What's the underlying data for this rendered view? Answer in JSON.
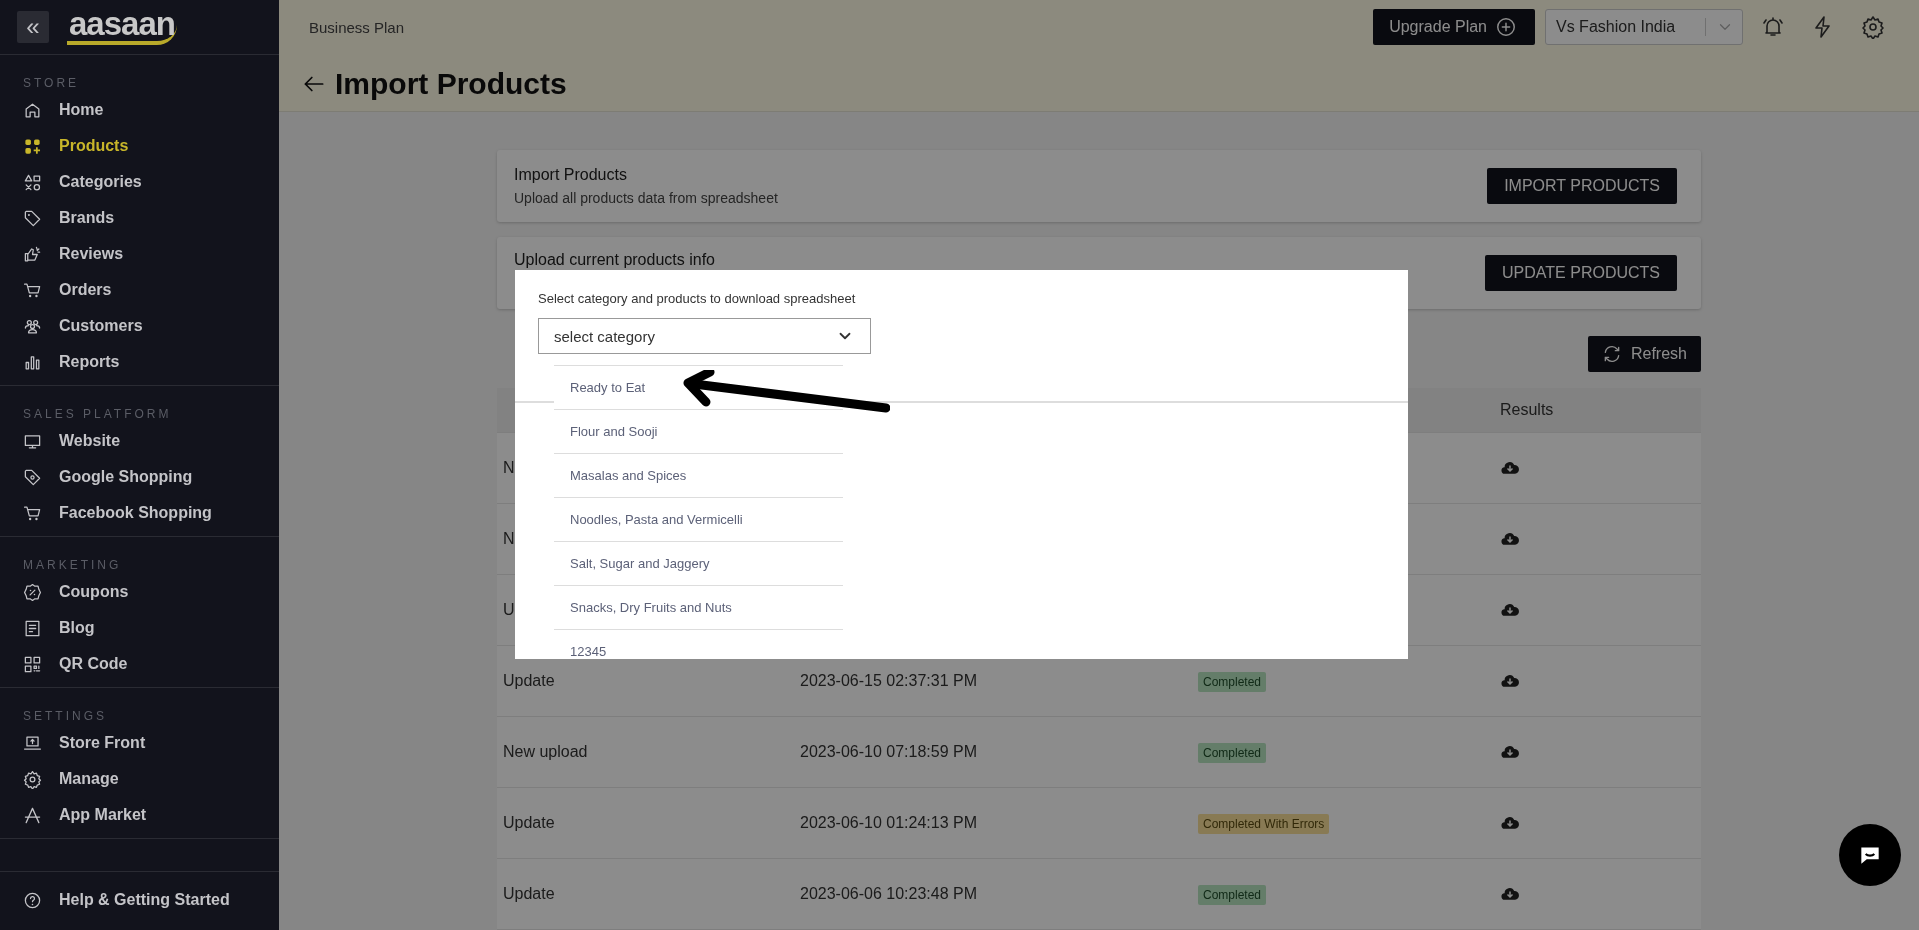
{
  "sidebar": {
    "collapse": "«",
    "logo": "aasaan",
    "sections": [
      {
        "label": "STORE",
        "items": [
          {
            "label": "Home",
            "selected": false
          },
          {
            "label": "Products",
            "selected": true
          },
          {
            "label": "Categories",
            "selected": false
          },
          {
            "label": "Brands",
            "selected": false
          },
          {
            "label": "Reviews",
            "selected": false
          },
          {
            "label": "Orders",
            "selected": false
          },
          {
            "label": "Customers",
            "selected": false
          },
          {
            "label": "Reports",
            "selected": false
          }
        ]
      },
      {
        "label": "SALES PLATFORM",
        "items": [
          {
            "label": "Website",
            "selected": false
          },
          {
            "label": "Google Shopping",
            "selected": false
          },
          {
            "label": "Facebook Shopping",
            "selected": false
          }
        ]
      },
      {
        "label": "MARKETING",
        "items": [
          {
            "label": "Coupons",
            "selected": false
          },
          {
            "label": "Blog",
            "selected": false
          },
          {
            "label": "QR Code",
            "selected": false
          }
        ]
      },
      {
        "label": "SETTINGS",
        "items": [
          {
            "label": "Store Front",
            "selected": false
          },
          {
            "label": "Manage",
            "selected": false
          },
          {
            "label": "App Market",
            "selected": false
          }
        ]
      }
    ],
    "help": "Help & Getting Started"
  },
  "header": {
    "plan": "Business Plan",
    "upgrade_button": "Upgrade Plan",
    "store_select": {
      "value": "Vs Fashion India"
    },
    "page_title": "Import Products"
  },
  "cards": [
    {
      "title": "Import Products",
      "subtitle": "Upload all products data from spreadsheet",
      "button": "IMPORT PRODUCTS"
    },
    {
      "title": "Upload current products info",
      "button": "UPDATE PRODUCTS"
    }
  ],
  "refresh_button": "Refresh",
  "table": {
    "results_heading": "Results",
    "rows": [
      {
        "type": "N"
      },
      {
        "type": "N"
      },
      {
        "type": "U"
      },
      {
        "type": "Update",
        "date": "2023-06-15 02:37:31 PM",
        "status": {
          "label": "Completed",
          "kind": "success"
        }
      },
      {
        "type": "New upload",
        "date": "2023-06-10 07:18:59 PM",
        "status": {
          "label": "Completed",
          "kind": "success"
        }
      },
      {
        "type": "Update",
        "date": "2023-06-10 01:24:13 PM",
        "status": {
          "label": "Completed With Errors",
          "kind": "warning"
        }
      },
      {
        "type": "Update",
        "date": "2023-06-06 10:23:48 PM",
        "status": {
          "label": "Completed",
          "kind": "success"
        }
      }
    ]
  },
  "modal": {
    "prompt": "Select category and products to download spreadsheet",
    "select": {
      "placeholder": "select category"
    },
    "options": [
      "Ready to Eat",
      "Flour and Sooji",
      "Masalas and Spices",
      "Noodles, Pasta and Vermicelli",
      "Salt, Sugar and Jaggery",
      "Snacks, Dry Fruits and Nuts",
      "12345"
    ]
  }
}
